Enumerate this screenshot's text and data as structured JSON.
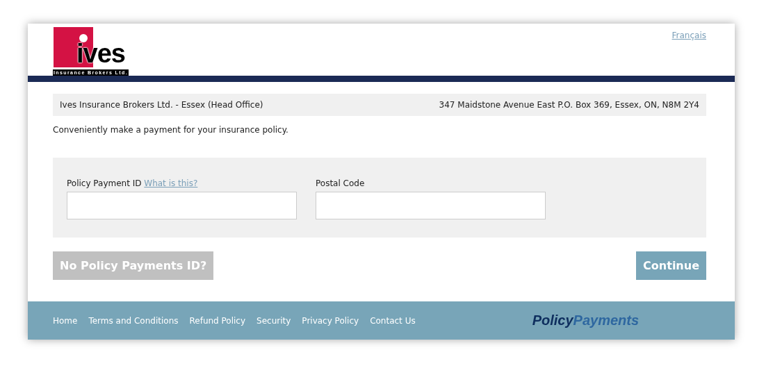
{
  "header": {
    "logo": {
      "wordmark": "ives",
      "tagline": "Insurance Brokers Ltd."
    },
    "language_link": "Français"
  },
  "office": {
    "name": "Ives Insurance Brokers Ltd. - Essex (Head Office)",
    "address": "347 Maidstone Avenue East P.O. Box 369, Essex, ON, N8M 2Y4"
  },
  "intro": "Conveniently make a payment for your insurance policy.",
  "form": {
    "fields": [
      {
        "label": "Policy Payment ID",
        "help_link": "What is this?"
      },
      {
        "label": "Postal Code"
      }
    ]
  },
  "buttons": {
    "secondary": {
      "label": "No Policy Payments ID?"
    },
    "primary": {
      "label": "Continue"
    }
  },
  "footer": {
    "links": [
      "Home",
      "Terms and Conditions",
      "Refund Policy",
      "Security",
      "Privacy Policy",
      "Contact Us"
    ],
    "brand": {
      "part_1": "Policy",
      "part_2": "Payments"
    }
  }
}
